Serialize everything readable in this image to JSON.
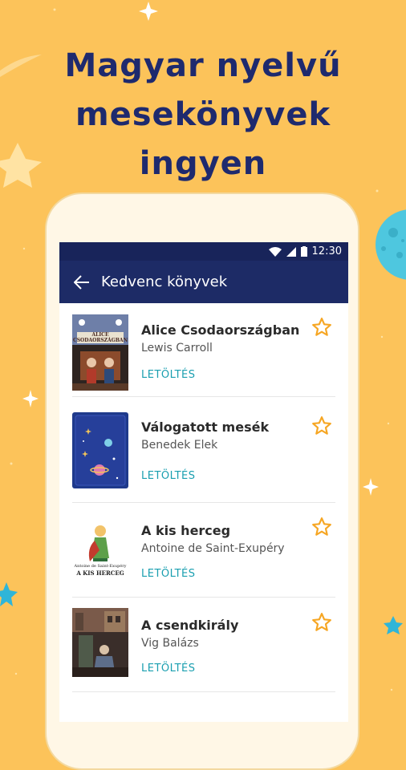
{
  "headline": {
    "line1": "Magyar nyelvű",
    "line2": "mesekönyvek",
    "line3": "ingyen"
  },
  "status_bar": {
    "time": "12:30"
  },
  "app_bar": {
    "title": "Kedvenc könyvek",
    "back_icon": "arrow-left-icon"
  },
  "books": [
    {
      "title": "Alice Csodaországban",
      "author": "Lewis Carroll",
      "action": "LETÖLTÉS",
      "cover_text": [
        "ALICE",
        "CSODAORSZÁGBAN"
      ]
    },
    {
      "title": "Válogatott mesék",
      "author": "Benedek Elek",
      "action": "LETÖLTÉS"
    },
    {
      "title": "A kis herceg",
      "author": "Antoine de Saint-Exupéry",
      "action": "LETÖLTÉS",
      "cover_text": [
        "Antoine de Saint-Exupéry",
        "A KIS HERCEG"
      ]
    },
    {
      "title": "A csendkirály",
      "author": "Vig Balázs",
      "action": "LETÖLTÉS"
    }
  ],
  "colors": {
    "background": "#FCC35A",
    "headline": "#1E2A6E",
    "app_bar": "#1D2B66",
    "accent": "#1A9FB0",
    "star": "#F6A623"
  }
}
